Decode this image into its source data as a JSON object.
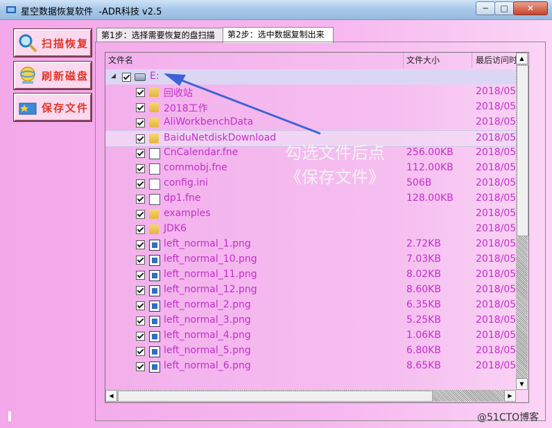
{
  "window": {
    "title": "星空数据恢复软件  -ADR科技 v2.5",
    "min_glyph": "─",
    "max_glyph": "□",
    "close_glyph": "✕"
  },
  "side_buttons": [
    {
      "label": "扫描恢复",
      "icon": "magnifier-icon"
    },
    {
      "label": "刷新磁盘",
      "icon": "refresh-globe-icon"
    },
    {
      "label": "保存文件",
      "icon": "save-folder-icon"
    }
  ],
  "tabs": [
    {
      "label": "第1步：选择需要恢复的盘扫描"
    },
    {
      "label": "第2步：选中数据复制出来"
    }
  ],
  "columns": {
    "name": "文件名",
    "size": "文件大小",
    "date": "最后访问时"
  },
  "root": {
    "name": "E:",
    "icon": "drive-icon"
  },
  "files": [
    {
      "name": "回收站",
      "size": "",
      "date": "2018/05",
      "type": "folder"
    },
    {
      "name": "2018工作",
      "size": "",
      "date": "2018/05",
      "type": "folder"
    },
    {
      "name": "AliWorkbenchData",
      "size": "",
      "date": "2018/05",
      "type": "folder"
    },
    {
      "name": "BaiduNetdiskDownload",
      "size": "",
      "date": "2018/05",
      "type": "folder"
    },
    {
      "name": "CnCalendar.fne",
      "size": "256.00KB",
      "date": "2018/05",
      "type": "doc"
    },
    {
      "name": "commobj.fne",
      "size": "112.00KB",
      "date": "2018/05",
      "type": "doc"
    },
    {
      "name": "config.ini",
      "size": "506B",
      "date": "2018/05",
      "type": "ini"
    },
    {
      "name": "dp1.fne",
      "size": "128.00KB",
      "date": "2018/05",
      "type": "doc"
    },
    {
      "name": "examples",
      "size": "",
      "date": "2018/05",
      "type": "folder"
    },
    {
      "name": "JDK6",
      "size": "",
      "date": "2018/05",
      "type": "folder"
    },
    {
      "name": "left_normal_1.png",
      "size": "2.72KB",
      "date": "2018/05",
      "type": "png"
    },
    {
      "name": "left_normal_10.png",
      "size": "7.03KB",
      "date": "2018/05",
      "type": "png"
    },
    {
      "name": "left_normal_11.png",
      "size": "8.02KB",
      "date": "2018/05",
      "type": "png"
    },
    {
      "name": "left_normal_12.png",
      "size": "8.60KB",
      "date": "2018/05",
      "type": "png"
    },
    {
      "name": "left_normal_2.png",
      "size": "6.35KB",
      "date": "2018/05",
      "type": "png"
    },
    {
      "name": "left_normal_3.png",
      "size": "5.25KB",
      "date": "2018/05",
      "type": "png"
    },
    {
      "name": "left_normal_4.png",
      "size": "1.06KB",
      "date": "2018/05",
      "type": "png"
    },
    {
      "name": "left_normal_5.png",
      "size": "6.80KB",
      "date": "2018/05",
      "type": "png"
    },
    {
      "name": "left_normal_6.png",
      "size": "8.65KB",
      "date": "2018/05",
      "type": "png"
    }
  ],
  "annotation": {
    "line1": "勾选文件后点",
    "line2": "《保存文件》"
  },
  "watermark": "@51CTO博客",
  "colors": {
    "file_text": "#c030c8",
    "button_text": "#e1372a",
    "arrow": "#3e63d6"
  }
}
